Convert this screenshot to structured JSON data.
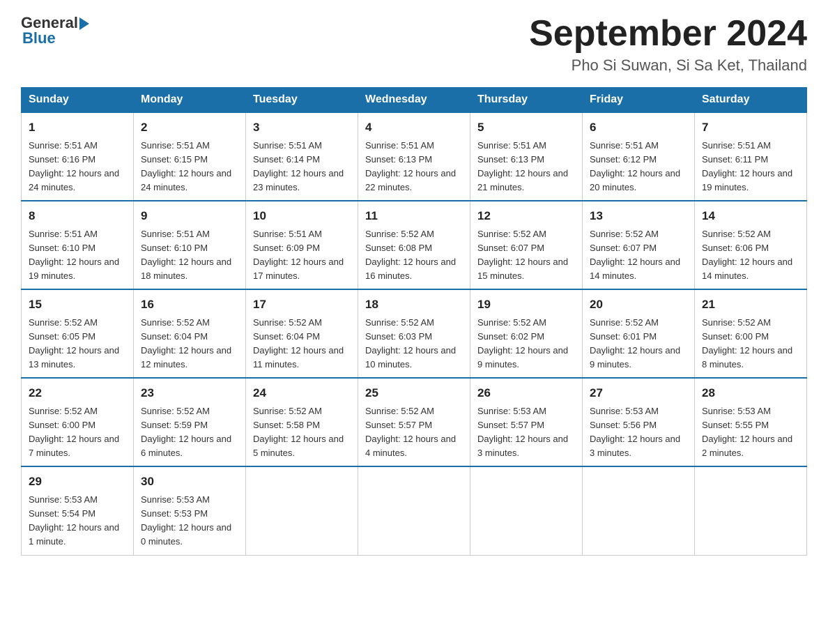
{
  "logo": {
    "general": "General",
    "blue": "Blue",
    "triangle_color": "#1a6fa8"
  },
  "header": {
    "title": "September 2024",
    "subtitle": "Pho Si Suwan, Si Sa Ket, Thailand"
  },
  "days_of_week": [
    "Sunday",
    "Monday",
    "Tuesday",
    "Wednesday",
    "Thursday",
    "Friday",
    "Saturday"
  ],
  "weeks": [
    [
      {
        "day": "1",
        "sunrise": "Sunrise: 5:51 AM",
        "sunset": "Sunset: 6:16 PM",
        "daylight": "Daylight: 12 hours and 24 minutes."
      },
      {
        "day": "2",
        "sunrise": "Sunrise: 5:51 AM",
        "sunset": "Sunset: 6:15 PM",
        "daylight": "Daylight: 12 hours and 24 minutes."
      },
      {
        "day": "3",
        "sunrise": "Sunrise: 5:51 AM",
        "sunset": "Sunset: 6:14 PM",
        "daylight": "Daylight: 12 hours and 23 minutes."
      },
      {
        "day": "4",
        "sunrise": "Sunrise: 5:51 AM",
        "sunset": "Sunset: 6:13 PM",
        "daylight": "Daylight: 12 hours and 22 minutes."
      },
      {
        "day": "5",
        "sunrise": "Sunrise: 5:51 AM",
        "sunset": "Sunset: 6:13 PM",
        "daylight": "Daylight: 12 hours and 21 minutes."
      },
      {
        "day": "6",
        "sunrise": "Sunrise: 5:51 AM",
        "sunset": "Sunset: 6:12 PM",
        "daylight": "Daylight: 12 hours and 20 minutes."
      },
      {
        "day": "7",
        "sunrise": "Sunrise: 5:51 AM",
        "sunset": "Sunset: 6:11 PM",
        "daylight": "Daylight: 12 hours and 19 minutes."
      }
    ],
    [
      {
        "day": "8",
        "sunrise": "Sunrise: 5:51 AM",
        "sunset": "Sunset: 6:10 PM",
        "daylight": "Daylight: 12 hours and 19 minutes."
      },
      {
        "day": "9",
        "sunrise": "Sunrise: 5:51 AM",
        "sunset": "Sunset: 6:10 PM",
        "daylight": "Daylight: 12 hours and 18 minutes."
      },
      {
        "day": "10",
        "sunrise": "Sunrise: 5:51 AM",
        "sunset": "Sunset: 6:09 PM",
        "daylight": "Daylight: 12 hours and 17 minutes."
      },
      {
        "day": "11",
        "sunrise": "Sunrise: 5:52 AM",
        "sunset": "Sunset: 6:08 PM",
        "daylight": "Daylight: 12 hours and 16 minutes."
      },
      {
        "day": "12",
        "sunrise": "Sunrise: 5:52 AM",
        "sunset": "Sunset: 6:07 PM",
        "daylight": "Daylight: 12 hours and 15 minutes."
      },
      {
        "day": "13",
        "sunrise": "Sunrise: 5:52 AM",
        "sunset": "Sunset: 6:07 PM",
        "daylight": "Daylight: 12 hours and 14 minutes."
      },
      {
        "day": "14",
        "sunrise": "Sunrise: 5:52 AM",
        "sunset": "Sunset: 6:06 PM",
        "daylight": "Daylight: 12 hours and 14 minutes."
      }
    ],
    [
      {
        "day": "15",
        "sunrise": "Sunrise: 5:52 AM",
        "sunset": "Sunset: 6:05 PM",
        "daylight": "Daylight: 12 hours and 13 minutes."
      },
      {
        "day": "16",
        "sunrise": "Sunrise: 5:52 AM",
        "sunset": "Sunset: 6:04 PM",
        "daylight": "Daylight: 12 hours and 12 minutes."
      },
      {
        "day": "17",
        "sunrise": "Sunrise: 5:52 AM",
        "sunset": "Sunset: 6:04 PM",
        "daylight": "Daylight: 12 hours and 11 minutes."
      },
      {
        "day": "18",
        "sunrise": "Sunrise: 5:52 AM",
        "sunset": "Sunset: 6:03 PM",
        "daylight": "Daylight: 12 hours and 10 minutes."
      },
      {
        "day": "19",
        "sunrise": "Sunrise: 5:52 AM",
        "sunset": "Sunset: 6:02 PM",
        "daylight": "Daylight: 12 hours and 9 minutes."
      },
      {
        "day": "20",
        "sunrise": "Sunrise: 5:52 AM",
        "sunset": "Sunset: 6:01 PM",
        "daylight": "Daylight: 12 hours and 9 minutes."
      },
      {
        "day": "21",
        "sunrise": "Sunrise: 5:52 AM",
        "sunset": "Sunset: 6:00 PM",
        "daylight": "Daylight: 12 hours and 8 minutes."
      }
    ],
    [
      {
        "day": "22",
        "sunrise": "Sunrise: 5:52 AM",
        "sunset": "Sunset: 6:00 PM",
        "daylight": "Daylight: 12 hours and 7 minutes."
      },
      {
        "day": "23",
        "sunrise": "Sunrise: 5:52 AM",
        "sunset": "Sunset: 5:59 PM",
        "daylight": "Daylight: 12 hours and 6 minutes."
      },
      {
        "day": "24",
        "sunrise": "Sunrise: 5:52 AM",
        "sunset": "Sunset: 5:58 PM",
        "daylight": "Daylight: 12 hours and 5 minutes."
      },
      {
        "day": "25",
        "sunrise": "Sunrise: 5:52 AM",
        "sunset": "Sunset: 5:57 PM",
        "daylight": "Daylight: 12 hours and 4 minutes."
      },
      {
        "day": "26",
        "sunrise": "Sunrise: 5:53 AM",
        "sunset": "Sunset: 5:57 PM",
        "daylight": "Daylight: 12 hours and 3 minutes."
      },
      {
        "day": "27",
        "sunrise": "Sunrise: 5:53 AM",
        "sunset": "Sunset: 5:56 PM",
        "daylight": "Daylight: 12 hours and 3 minutes."
      },
      {
        "day": "28",
        "sunrise": "Sunrise: 5:53 AM",
        "sunset": "Sunset: 5:55 PM",
        "daylight": "Daylight: 12 hours and 2 minutes."
      }
    ],
    [
      {
        "day": "29",
        "sunrise": "Sunrise: 5:53 AM",
        "sunset": "Sunset: 5:54 PM",
        "daylight": "Daylight: 12 hours and 1 minute."
      },
      {
        "day": "30",
        "sunrise": "Sunrise: 5:53 AM",
        "sunset": "Sunset: 5:53 PM",
        "daylight": "Daylight: 12 hours and 0 minutes."
      },
      null,
      null,
      null,
      null,
      null
    ]
  ]
}
